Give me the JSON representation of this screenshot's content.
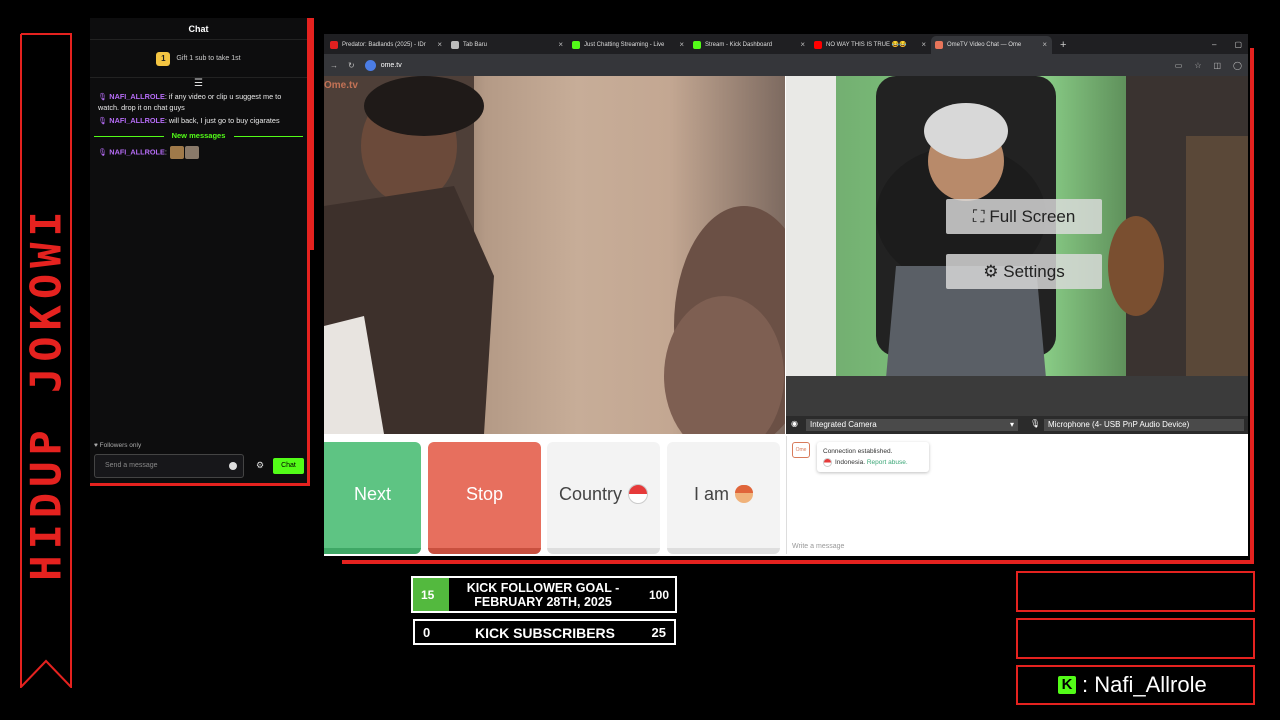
{
  "banner": {
    "text": "HIDUP JOKOWI"
  },
  "chat": {
    "title": "Chat",
    "gift_badge": "1",
    "gift_text": "Gift 1 sub to take 1st",
    "messages": [
      {
        "user": "NAFI_ALLROLE",
        "text": ": if any video or clip u suggest me to watch. drop it on chat guys"
      },
      {
        "user": "NAFI_ALLROLE",
        "text": ": will back, I just go to buy cigarates"
      }
    ],
    "new_messages_label": "New messages",
    "after_messages": [
      {
        "user": "NAFI_ALLROLE",
        "text": ":"
      }
    ],
    "followers_only": "♥ Followers only",
    "send_placeholder": "Send a message",
    "chat_button": "Chat"
  },
  "browser": {
    "tabs": [
      {
        "title": "Predator: Badlands (2025) - IDr",
        "icon_color": "#e02020"
      },
      {
        "title": "Tab Baru",
        "icon_color": "#bbbbbb"
      },
      {
        "title": "Just Chatting Streaming - Live",
        "icon_color": "#53fc18"
      },
      {
        "title": "Stream - Kick Dashboard",
        "icon_color": "#53fc18"
      },
      {
        "title": "NO WAY THIS IS TRUE 😂😂",
        "icon_color": "#ff0000"
      },
      {
        "title": "OmeTV Video Chat — Ome",
        "icon_color": "#e8755a"
      }
    ],
    "url": "ome.tv"
  },
  "ometv": {
    "logo": "Ome.tv",
    "full_screen": "Full Screen",
    "settings": "Settings",
    "camera": "Integrated Camera",
    "microphone": "Microphone (4- USB PnP Audio Device)",
    "buttons": {
      "next": "Next",
      "stop": "Stop",
      "country": "Country",
      "i_am": "I am"
    },
    "system_msg": {
      "line1": "Connection established.",
      "country": "Indonesia.",
      "report": "Report abuse."
    },
    "write_placeholder": "Write a message"
  },
  "goal": {
    "current": "15",
    "title": "KICK FOLLOWER GOAL - FEBRUARY 28TH, 2025",
    "target": "100",
    "progress": 0.15
  },
  "subs": {
    "current": "0",
    "title": "KICK SUBSCRIBERS",
    "target": "25"
  },
  "handle": {
    "name": ": Nafi_Allrole",
    "logo": "K"
  },
  "colors": {
    "accent": "#e5221f",
    "kick_green": "#53fc18"
  }
}
